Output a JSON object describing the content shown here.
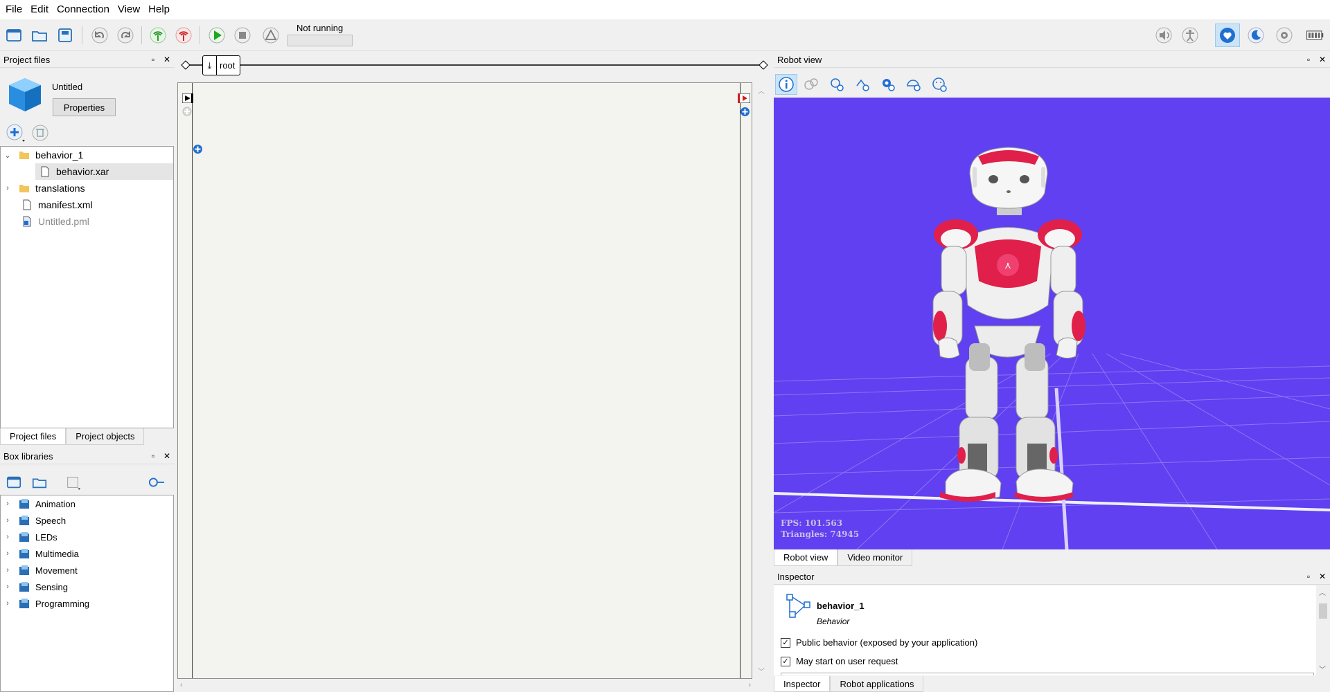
{
  "menu": [
    "File",
    "Edit",
    "Connection",
    "View",
    "Help"
  ],
  "toolbar": {
    "status_label": "Not running",
    "icons": [
      "new-project-icon",
      "open-project-icon",
      "save-project-icon",
      "undo-icon",
      "redo-icon",
      "connect-icon",
      "disconnect-icon",
      "play-icon",
      "stop-icon",
      "debug-warning-icon",
      "volume-icon",
      "robot-stiffness-icon",
      "autonomous-life-icon",
      "sleep-mode-icon",
      "settings-icon",
      "battery-icon"
    ]
  },
  "project_files": {
    "title": "Project files",
    "project_name": "Untitled",
    "properties_button": "Properties",
    "tree": [
      {
        "label": "behavior_1",
        "type": "folder",
        "expanded": true,
        "depth": 0
      },
      {
        "label": "behavior.xar",
        "type": "file",
        "depth": 1,
        "selected": true
      },
      {
        "label": "translations",
        "type": "folder",
        "expanded": false,
        "depth": 0
      },
      {
        "label": "manifest.xml",
        "type": "file",
        "depth": 0
      },
      {
        "label": "Untitled.pml",
        "type": "pml",
        "depth": 0,
        "dimmed": true
      }
    ],
    "tabs": [
      "Project files",
      "Project objects"
    ]
  },
  "box_libraries": {
    "title": "Box libraries",
    "items": [
      "Animation",
      "Speech",
      "LEDs",
      "Multimedia",
      "Movement",
      "Sensing",
      "Programming"
    ]
  },
  "diagram": {
    "breadcrumb": "root"
  },
  "robot_view": {
    "title": "Robot view",
    "fps": "FPS: 101.563",
    "triangles": "Triangles: 74945",
    "tabs": [
      "Robot view",
      "Video monitor"
    ]
  },
  "inspector": {
    "title": "Inspector",
    "name": "behavior_1",
    "kind": "Behavior",
    "options": [
      {
        "label": "Public behavior (exposed by your application)",
        "checked": true
      },
      {
        "label": "May start on user request",
        "checked": true
      }
    ],
    "tabs": [
      "Inspector",
      "Robot applications"
    ]
  },
  "colors": {
    "scene_bg": "#6040f0",
    "robot_accent": "#e0204a",
    "selection": "#cce4f7"
  }
}
